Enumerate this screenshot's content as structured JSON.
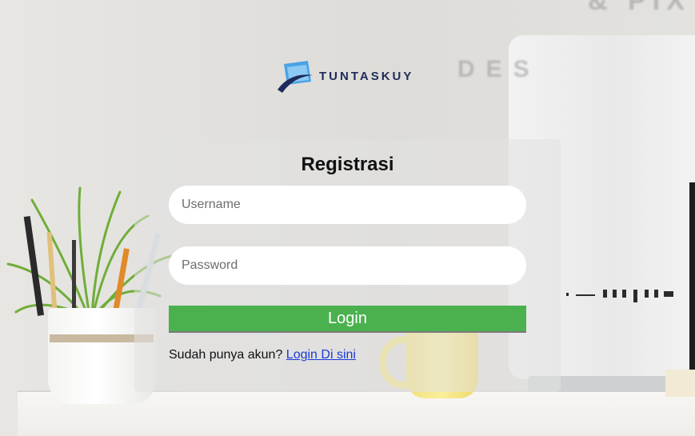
{
  "brand": {
    "name": "TUNTASKUY",
    "color": "#1f2a5a",
    "accent": "#3a8fd6"
  },
  "form": {
    "title": "Registrasi",
    "username_placeholder": "Username",
    "password_placeholder": "Password",
    "submit_label": "Login",
    "footer_prompt": "Sudah punya akun?",
    "footer_link": "Login Di sini"
  },
  "colors": {
    "button": "#4bb14f",
    "link": "#1a3ad8"
  },
  "icons": [
    "tuntaskuy-logo-icon"
  ]
}
